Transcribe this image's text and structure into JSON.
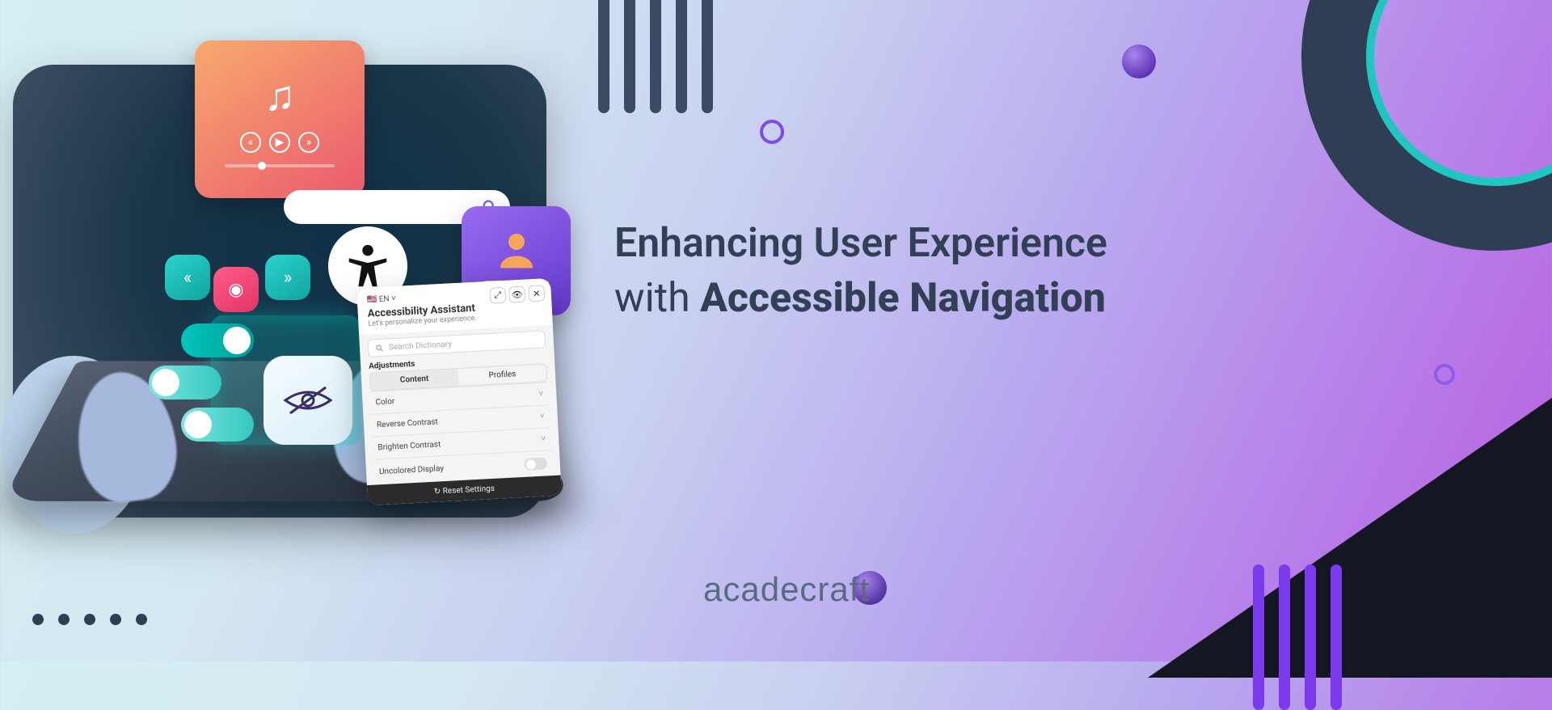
{
  "headline": {
    "line1": "Enhancing User Experience",
    "with": "with",
    "bold": "Accessible Navigation"
  },
  "brand": "acadecraft",
  "panel": {
    "lang": "🇺🇸 EN ˅",
    "title": "Accessibility Assistant",
    "subtitle": "Let's personalize your experience.",
    "search_placeholder": "Search Dictionary",
    "section": "Adjustments",
    "tab_content": "Content",
    "tab_profiles": "Profiles",
    "row_color": "Color",
    "row_reverse": "Reverse Contrast",
    "row_brighten": "Brighten Contrast",
    "row_uncolored": "Uncolored Display",
    "reset": "↻  Reset Settings"
  },
  "icons": {
    "music": "music-note-icon",
    "rewind": "rewind-icon",
    "play": "play-icon",
    "forward": "forward-icon",
    "search": "search-icon",
    "a11y": "accessibility-icon",
    "avatar": "person-icon",
    "lowvision": "low-vision-icon",
    "close": "✕",
    "move": "⤢",
    "eye": "👁"
  },
  "colors": {
    "heading": "#324056",
    "accent_purple": "#7c3aed",
    "accent_teal": "#1fc7c0"
  }
}
